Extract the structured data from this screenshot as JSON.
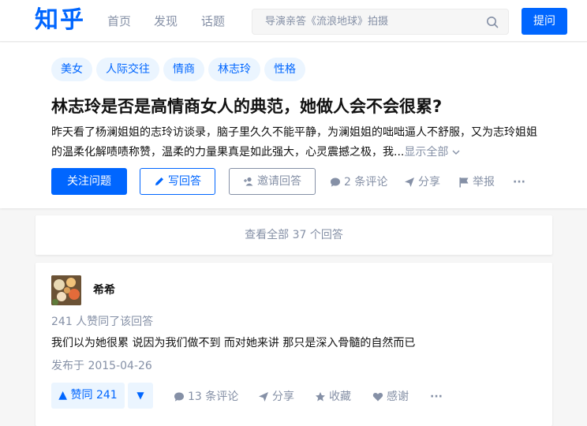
{
  "header": {
    "logo": "知乎",
    "nav": [
      "首页",
      "发现",
      "话题"
    ],
    "search_placeholder": "导演亲答《流浪地球》拍摄",
    "ask_label": "提问"
  },
  "question": {
    "tags": [
      "美女",
      "人际交往",
      "情商",
      "林志玲",
      "性格"
    ],
    "title": "林志玲是否是高情商女人的典范，她做人会不会很累?",
    "desc_line1": "昨天看了杨澜姐姐的志玲访谈录，脑子里久久不能平静，为澜姐姐的咄咄逼人不舒服，又为志玲姐姐",
    "desc_line2": "的温柔化解啧啧称赞，温柔的力量果真是如此强大，心灵震撼之极，我...",
    "show_all": "显示全部",
    "follow_label": "关注问题",
    "write_label": "写回答",
    "invite_label": "邀请回答",
    "comments_label": "2 条评论",
    "share_label": "分享",
    "report_label": "举报",
    "more_label": "···"
  },
  "view_all": "查看全部 37 个回答",
  "answer": {
    "author": "希希",
    "voters": "241 人赞同了该回答",
    "content": "我们以为她很累 说因为我们做不到 而对她来讲 那只是深入骨髓的自然而已",
    "published": "发布于 2015-04-26",
    "upvote_label": "▲ 赞同 241",
    "downvote_label": "▼",
    "comments_label": "13 条评论",
    "share_label": "分享",
    "collect_label": "收藏",
    "thanks_label": "感谢",
    "more_label": "···"
  },
  "colors": {
    "brand": "#0066ff",
    "muted": "#8590a6",
    "tag_bg": "#ebf5ff"
  }
}
